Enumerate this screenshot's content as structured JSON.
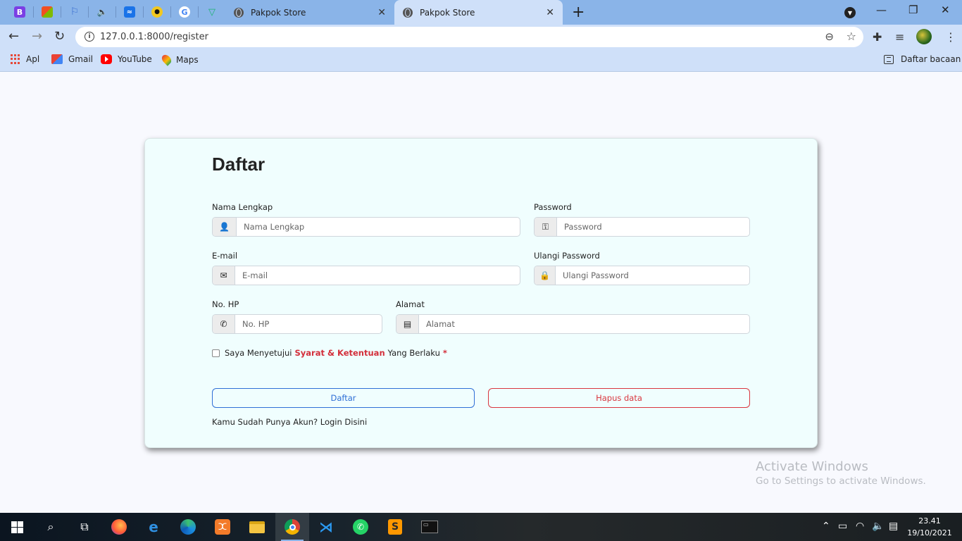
{
  "browser": {
    "pinned_tabs": [
      "B",
      "ms-teams-icon",
      "flag-icon",
      "audio-icon",
      "messenger-icon",
      "batman-icon",
      "google-icon",
      "vuetify-icon"
    ],
    "tabs": [
      {
        "title": "Pakpok Store",
        "active": false
      },
      {
        "title": "Pakpok Store",
        "active": true
      }
    ],
    "url": "127.0.0.1:8000/register",
    "bookmarks": [
      {
        "label": "Apl",
        "icon": "apps-grid-icon"
      },
      {
        "label": "Gmail",
        "icon": "gmail-icon"
      },
      {
        "label": "YouTube",
        "icon": "youtube-icon"
      },
      {
        "label": "Maps",
        "icon": "maps-icon"
      }
    ],
    "reading_list": "Daftar bacaan",
    "accent_color": "#8ab4e8"
  },
  "form": {
    "title": "Daftar",
    "fields": {
      "nama": {
        "label": "Nama Lengkap",
        "placeholder": "Nama Lengkap",
        "icon": "user-edit-icon"
      },
      "email": {
        "label": "E-mail",
        "placeholder": "E-mail",
        "icon": "envelope-icon"
      },
      "password": {
        "label": "Password",
        "placeholder": "Password",
        "icon": "key-icon"
      },
      "ulangi": {
        "label": "Ulangi Password",
        "placeholder": "Ulangi Password",
        "icon": "lock-icon"
      },
      "hp": {
        "label": "No. HP",
        "placeholder": "No. HP",
        "icon": "phone-icon"
      },
      "alamat": {
        "label": "Alamat",
        "placeholder": "Alamat",
        "icon": "address-card-icon"
      }
    },
    "agree": {
      "prefix": "Saya Menyetujui",
      "terms": "Syarat & Ketentuan",
      "suffix": "Yang Berlaku",
      "required": "*"
    },
    "submit_label": "Daftar",
    "reset_label": "Hapus data",
    "login_text": "Kamu Sudah Punya Akun? Login Disini",
    "colors": {
      "primary": "#2f6fd6",
      "danger": "#d9373f"
    }
  },
  "watermark": {
    "line1": "Activate Windows",
    "line2": "Go to Settings to activate Windows."
  },
  "taskbar": {
    "apps": [
      "firefox-icon",
      "edge-legacy-icon",
      "edge-icon",
      "xampp-icon",
      "file-explorer-icon",
      "chrome-icon",
      "vscode-icon",
      "whatsapp-icon",
      "sublime-icon",
      "terminal-icon"
    ],
    "time": "23.41",
    "date": "19/10/2021"
  }
}
